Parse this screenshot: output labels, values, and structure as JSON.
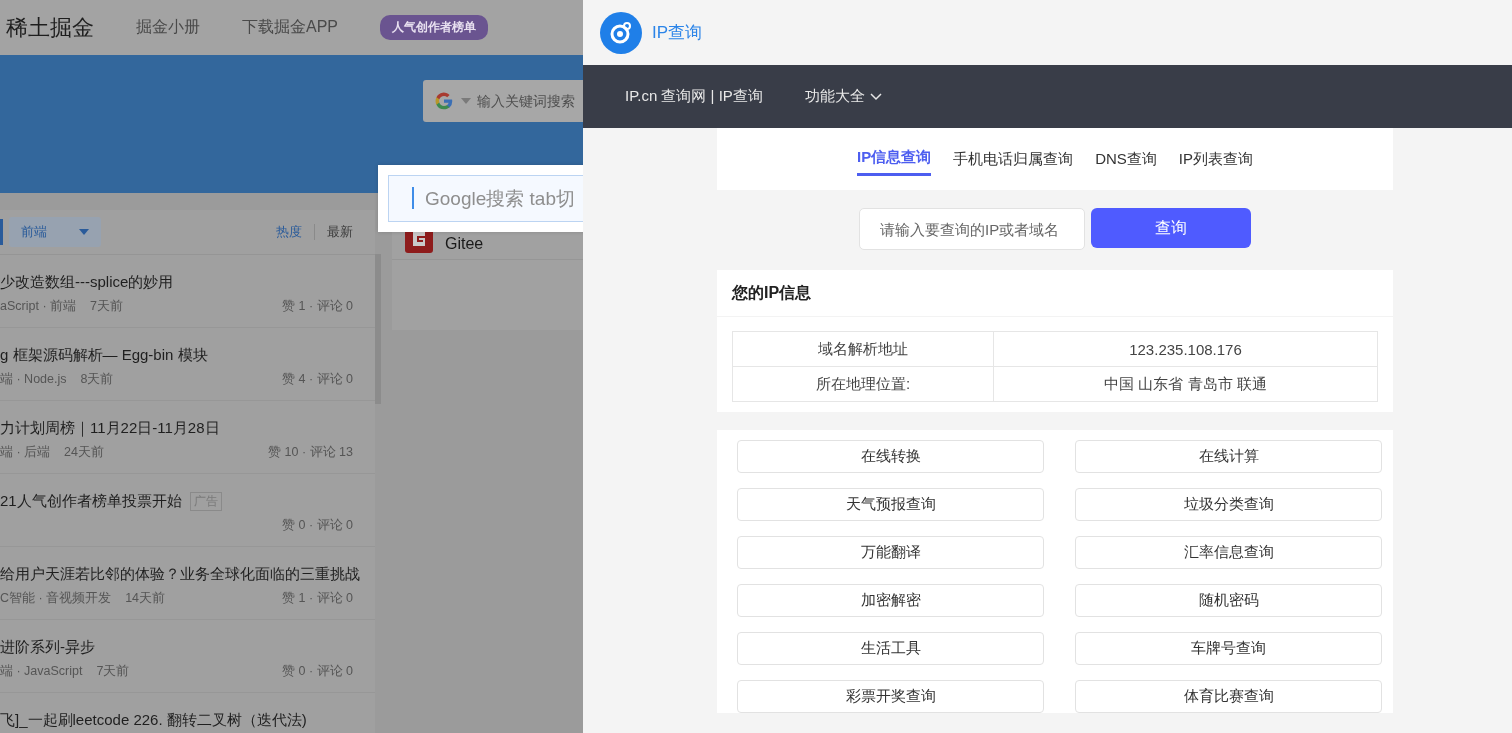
{
  "left_page": {
    "logo": "稀土掘金",
    "nav_links": [
      "掘金小册",
      "下载掘金APP"
    ],
    "banner_badge": "人气创作者榜单",
    "search": {
      "placeholder": "输入关键词搜索"
    },
    "search_popup": {
      "placeholder": "Google搜索 tab切"
    },
    "category_dropdown": "前端",
    "sort_tabs": [
      {
        "label": "热度",
        "selected": true
      },
      {
        "label": "最新",
        "selected": false
      }
    ],
    "articles": [
      {
        "title": "少改造数组---splice的妙用",
        "meta": "aScript · 前端",
        "time": "7天前",
        "stats": "赞 1 · 评论 0"
      },
      {
        "title": "g 框架源码解析— Egg-bin 模块",
        "meta": "端 · Node.js",
        "time": "8天前",
        "stats": "赞 4 · 评论 0"
      },
      {
        "title": "力计划周榜｜11月22日-11月28日",
        "meta": "端 · 后端",
        "time": "24天前",
        "stats": "赞 10 · 评论 13"
      },
      {
        "title": "21人气创作者榜单投票开始",
        "tag": "广告",
        "stats": "赞 0 · 评论 0"
      },
      {
        "title": "给用户天涯若比邻的体验？业务全球化面临的三重挑战",
        "meta": "C智能 · 音视频开发",
        "time": "14天前",
        "stats": "赞 1 · 评论 0"
      },
      {
        "title": "进阶系列-异步",
        "meta": "端 · JavaScript",
        "time": "7天前",
        "stats": "赞 0 · 评论 0"
      },
      {
        "title": "飞]_一起刷leetcode 226. 翻转二叉树（迭代法)"
      }
    ],
    "sidebar_card": {
      "title": "Gitee"
    }
  },
  "ip_tool": {
    "title": "IP查询",
    "nav_title": "IP.cn 查询网 | IP查询",
    "nav_menu": "功能大全",
    "tabs": [
      {
        "label": "IP信息查询",
        "selected": true
      },
      {
        "label": "手机电话归属查询",
        "selected": false
      },
      {
        "label": "DNS查询",
        "selected": false
      },
      {
        "label": "IP列表查询",
        "selected": false
      }
    ],
    "query": {
      "placeholder": "请输入要查询的IP或者域名",
      "button": "查询"
    },
    "info": {
      "title": "您的IP信息",
      "rows": [
        {
          "label": "域名解析地址",
          "value": "123.235.108.176"
        },
        {
          "label": "所在地理位置:",
          "value": "中国 山东省 青岛市 联通"
        }
      ]
    },
    "tools": [
      "在线转换",
      "在线计算",
      "天气预报查询",
      "垃圾分类查询",
      "万能翻译",
      "汇率信息查询",
      "加密解密",
      "随机密码",
      "生活工具",
      "车牌号查询",
      "彩票开奖查询",
      "体育比赛查询"
    ]
  }
}
